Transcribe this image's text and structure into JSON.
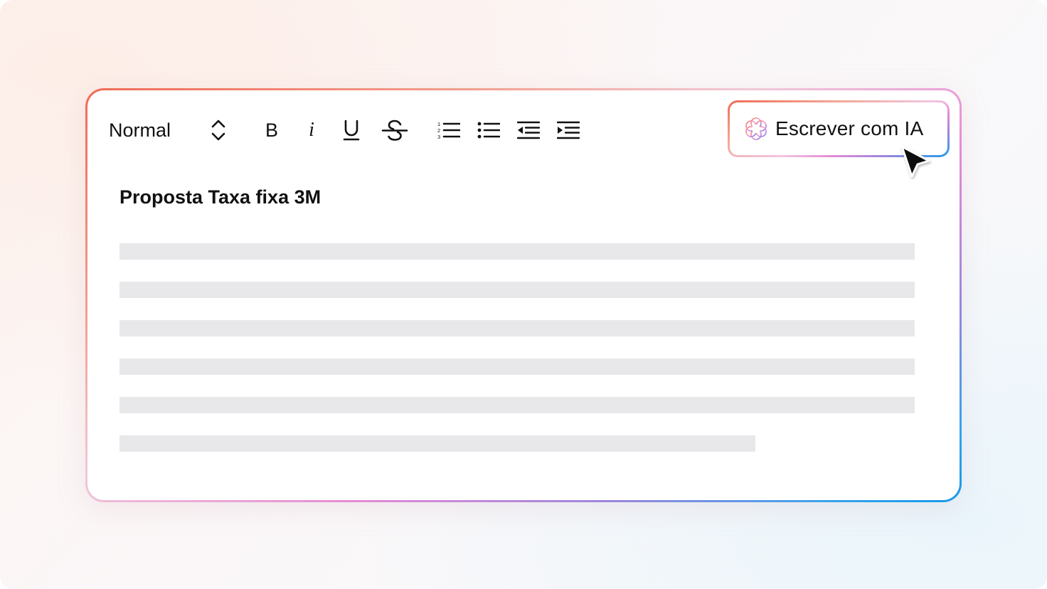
{
  "toolbar": {
    "paragraph_style": "Normal",
    "buttons": [
      {
        "name": "style-stepper",
        "icon": "chevron-up-down-icon"
      },
      {
        "name": "bold",
        "icon": "bold-icon",
        "glyph": "B"
      },
      {
        "name": "italic",
        "icon": "italic-icon",
        "glyph": "i"
      },
      {
        "name": "underline",
        "icon": "underline-icon",
        "glyph": "U"
      },
      {
        "name": "strikethrough",
        "icon": "strikethrough-icon",
        "glyph": "S"
      },
      {
        "name": "ordered-list",
        "icon": "ordered-list-icon"
      },
      {
        "name": "bullet-list",
        "icon": "bullet-list-icon"
      },
      {
        "name": "outdent",
        "icon": "outdent-icon"
      },
      {
        "name": "indent",
        "icon": "indent-icon"
      }
    ]
  },
  "ai_button": {
    "label": "Escrever com IA",
    "icon": "ai-ring-icon"
  },
  "document": {
    "title": "Proposta Taxa fixa 3M",
    "placeholder_line_count": 6
  },
  "colors": {
    "accent_start": "#f06a55",
    "accent_mid": "#e58ad6",
    "accent_end": "#169ae8",
    "skeleton": "#e8e8eb"
  }
}
